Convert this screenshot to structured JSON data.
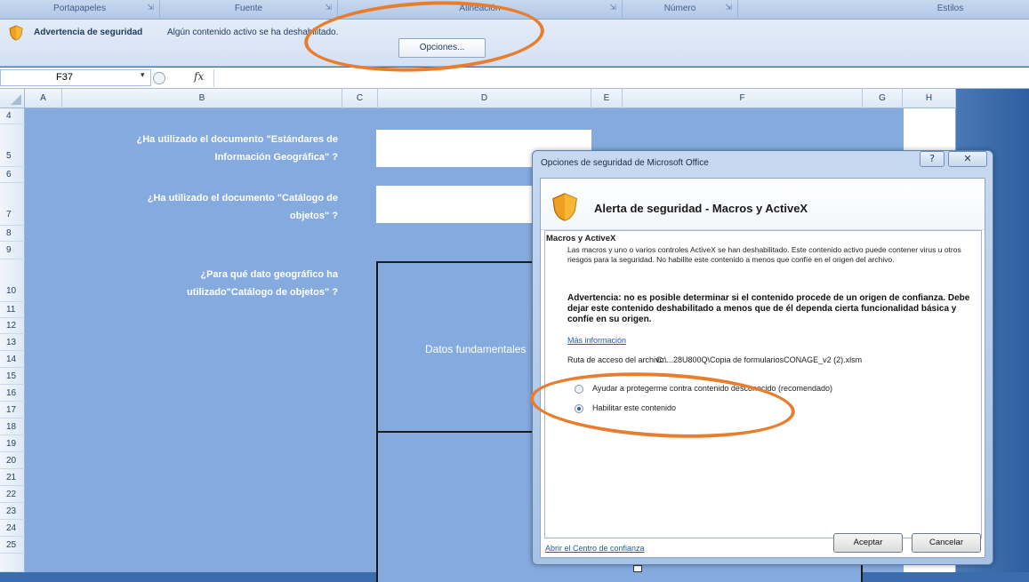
{
  "ribbon": {
    "groups": [
      "Portapapeles",
      "Fuente",
      "Alineación",
      "Número",
      "Estilos"
    ],
    "launcher_glyph": "⇲"
  },
  "security_bar": {
    "title": "Advertencia de seguridad",
    "message": "Algún contenido activo se ha deshabilitado.",
    "options_button": "Opciones..."
  },
  "formula_bar": {
    "cell_ref": "F37",
    "fx_label": "fx",
    "dropdown_glyph": "▾"
  },
  "columns": [
    "A",
    "B",
    "C",
    "D",
    "E",
    "F",
    "G",
    "H"
  ],
  "rows": [
    "4",
    "5",
    "6",
    "7",
    "8",
    "9",
    "10",
    "11",
    "12",
    "13",
    "14",
    "15",
    "16",
    "17",
    "18",
    "19",
    "20",
    "21",
    "22",
    "23",
    "24",
    "25"
  ],
  "sheet": {
    "q1_line1": "¿Ha utilizado el documento \"Estándares de",
    "q1_line2": "Información Geográfica\" ?",
    "q2_line1": "¿Ha utilizado el documento \"Catálogo de",
    "q2_line2": "objetos\" ?",
    "q3_line1": "¿Para qué dato geográfico ha",
    "q3_line2": "utilizado\"Catálogo de objetos\" ?",
    "datos": "Datos fundamentales"
  },
  "dialog": {
    "title": "Opciones de seguridad de Microsoft Office",
    "help_glyph": "?",
    "close_glyph": "✕",
    "alert_title": "Alerta de seguridad - Macros y ActiveX",
    "section_header": "Macros y ActiveX",
    "section_text": "Las macros y uno o varios controles ActiveX se han deshabilitado. Este contenido activo puede contener virus u otros riesgos para la seguridad. No habilite este contenido a menos que confíe en el origen del archivo.",
    "warning": "Advertencia: no es posible determinar si el contenido procede de un origen de confianza. Debe dejar este contenido deshabilitado a menos que de él dependa cierta funcionalidad básica y confíe en su origen.",
    "more_info": "Más información",
    "path_label": "Ruta de acceso del archivo:",
    "path_value": "C:\\...28U800Q\\Copia de formulariosCONAGE_v2 (2).xlsm",
    "radio_protect": "Ayudar a protegerme contra contenido desconocido (recomendado)",
    "radio_enable": "Habilitar este contenido",
    "trust_center": "Abrir el Centro de confianza",
    "ok_button": "Aceptar",
    "cancel_button": "Cancelar",
    "selected_option": "Habilitar este contenido"
  },
  "colors": {
    "sheet_bg": "#85aade",
    "annotation": "#e87d2e",
    "link": "#1f5bb3"
  }
}
